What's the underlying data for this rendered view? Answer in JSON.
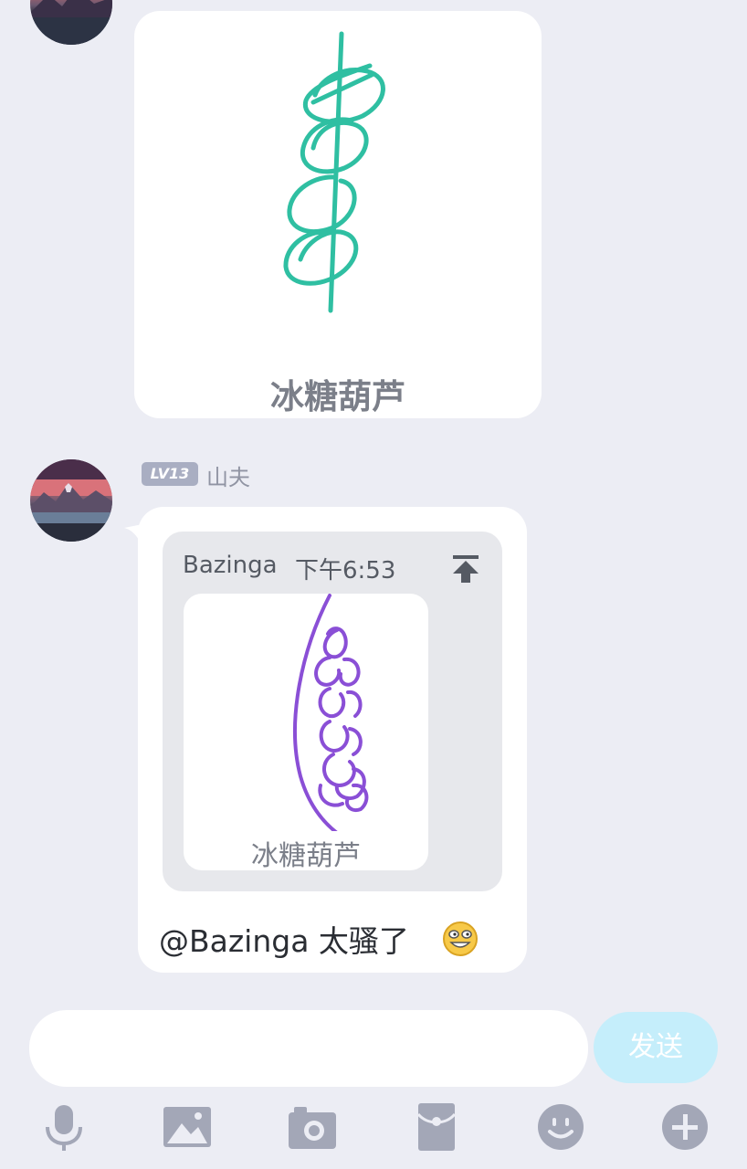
{
  "messages": [
    {
      "type": "drawing-card",
      "caption": "冰糖葫芦"
    },
    {
      "type": "reply",
      "user": {
        "level_badge": "LV13",
        "name": "山夫"
      },
      "quoted": {
        "author": "Bazinga",
        "time": "下午6:53",
        "caption": "冰糖葫芦"
      },
      "text": "@Bazinga 太骚了"
    }
  ],
  "composer": {
    "input_value": "",
    "send_label": "发送"
  },
  "toolbar": {
    "icons": [
      "microphone-icon",
      "image-icon",
      "camera-icon",
      "red-packet-icon",
      "emoji-icon",
      "plus-icon"
    ]
  },
  "colors": {
    "background": "#ecedf4",
    "drawing_teal": "#2fbfa2",
    "drawing_purple": "#8a4fd6",
    "send_button": "#c5eefb",
    "icon_gray": "#a3a7b7"
  }
}
